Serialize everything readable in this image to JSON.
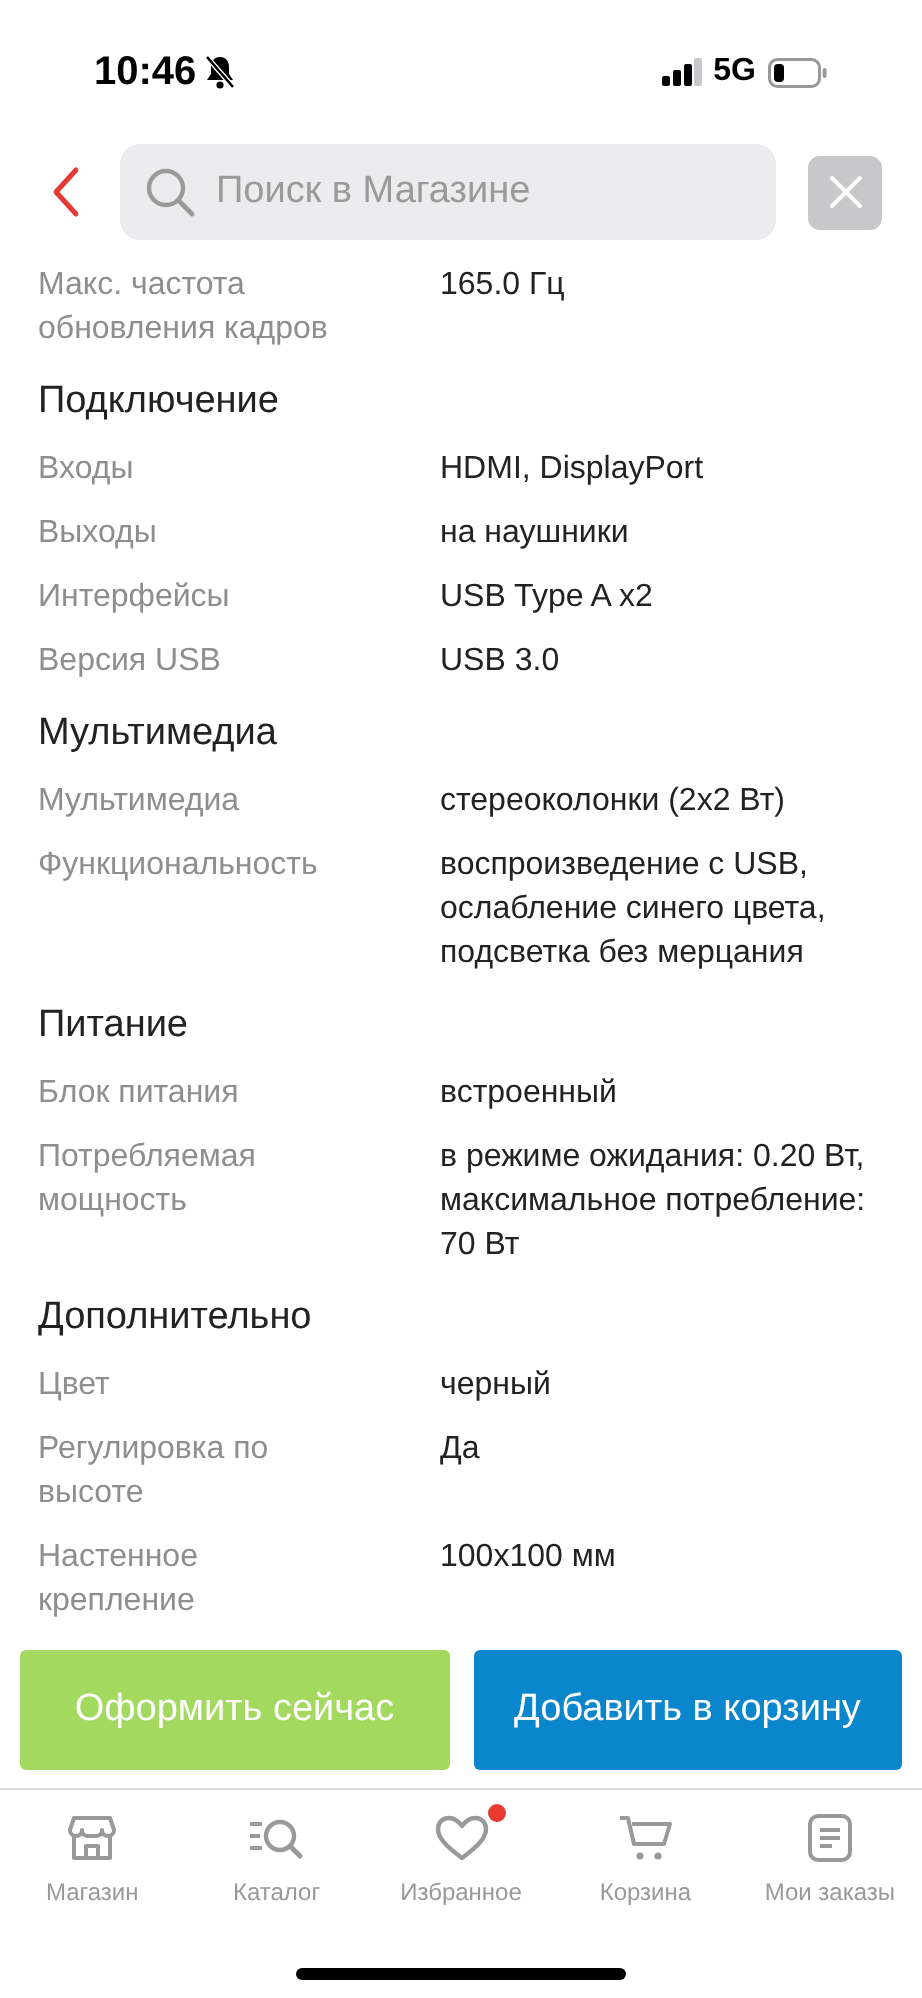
{
  "status_bar": {
    "time": "10:46",
    "silent": true,
    "network": "5G"
  },
  "search": {
    "placeholder": "Поиск в Магазине"
  },
  "specs": [
    {
      "kind": "row",
      "label": "Макс. частота обновления кадров",
      "value": "165.0 Гц"
    },
    {
      "kind": "heading",
      "label": "Подключение"
    },
    {
      "kind": "row",
      "label": "Входы",
      "value": "HDMI, DisplayPort"
    },
    {
      "kind": "row",
      "label": "Выходы",
      "value": "на наушники"
    },
    {
      "kind": "row",
      "label": "Интерфейсы",
      "value": "USB Type A x2"
    },
    {
      "kind": "row",
      "label": "Версия USB",
      "value": "USB 3.0"
    },
    {
      "kind": "heading",
      "label": "Мультимедиа"
    },
    {
      "kind": "row",
      "label": "Мультимедиа",
      "value": "стереоколонки (2x2 Вт)"
    },
    {
      "kind": "row",
      "label": "Функциональность",
      "value": "воспроизведение с USB, ослабление синего цвета, подсветка без мерцания"
    },
    {
      "kind": "heading",
      "label": "Питание"
    },
    {
      "kind": "row",
      "label": "Блок питания",
      "value": "встроенный"
    },
    {
      "kind": "row",
      "label": "Потребляемая мощность",
      "value": "в режиме ожидания: 0.20 Вт, максимальное потребление: 70 Вт"
    },
    {
      "kind": "heading",
      "label": "Дополнительно"
    },
    {
      "kind": "row",
      "label": "Цвет",
      "value": "черный"
    },
    {
      "kind": "row",
      "label": "Регулировка по высоте",
      "value": "Да"
    },
    {
      "kind": "row",
      "label": "Настенное крепление",
      "value": "100x100 мм"
    }
  ],
  "actions": [
    {
      "kind": "buy",
      "label": "Оформить сейчас"
    },
    {
      "kind": "cart",
      "label": "Добавить в корзину"
    }
  ],
  "tabs": [
    {
      "kind": "store",
      "label": "Магазин",
      "badge": false
    },
    {
      "kind": "catalog",
      "label": "Каталог",
      "badge": false
    },
    {
      "kind": "heart",
      "label": "Избранное",
      "badge": true
    },
    {
      "kind": "cart",
      "label": "Корзина",
      "badge": false
    },
    {
      "kind": "orders",
      "label": "Мои заказы",
      "badge": false
    }
  ]
}
